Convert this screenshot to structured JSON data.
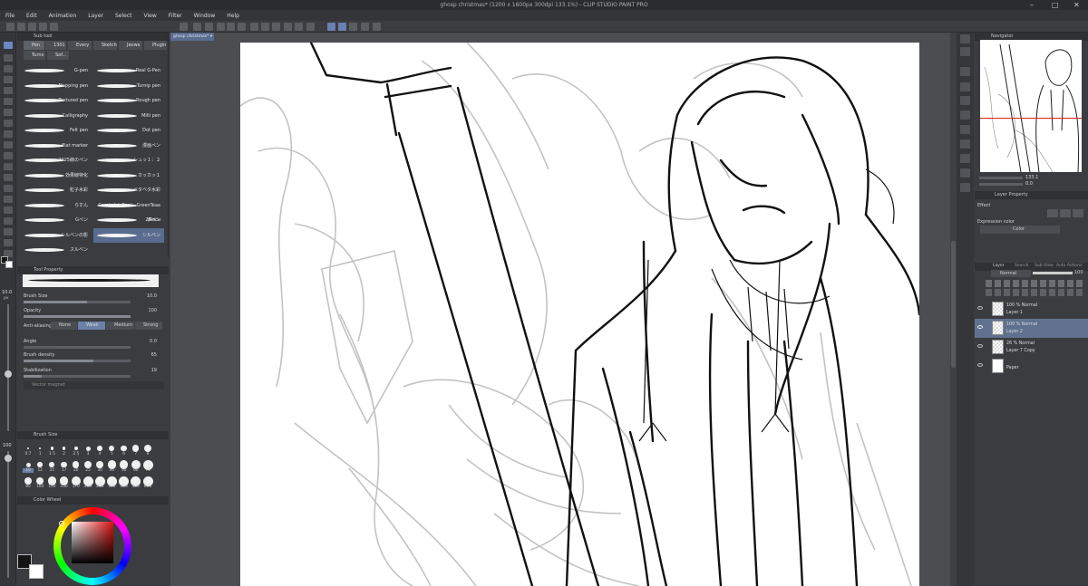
{
  "window": {
    "title": "ghosp christmas* (1200 x 1600px 300dpi 133.1%) - CLIP STUDIO PAINT PRO",
    "controls": [
      "–",
      "□",
      "✕"
    ]
  },
  "menu": [
    "File",
    "Edit",
    "Animation",
    "Layer",
    "Select",
    "View",
    "Filter",
    "Window",
    "Help"
  ],
  "document_tab": "ghosp christmas*",
  "subtool": {
    "panel_title": "Sub tool",
    "tabs_row1": [
      "Pen",
      "1301",
      "Every",
      "Sketch",
      "Jeows",
      "Plugin"
    ],
    "tabs_row2": [
      "Turns",
      "Sof..."
    ],
    "brushes_left": [
      "G-pen",
      "Mapping pen",
      "Textured pen",
      "Calligraphy",
      "Felt pen",
      "Flat marker",
      "2025線のペン",
      "効果線特化",
      "粒子水彩",
      "らすん",
      "Gペン",
      "シルベンの影",
      "スルベン"
    ],
    "brushes_right": [
      "Real G-Pen",
      "Turnip pen",
      "Rough pen",
      "Milli pen",
      "Dot pen",
      "漫画ペン",
      "シュッ１：２",
      "カッカッ１",
      "ベタベタ水彩",
      "Comic Ink Pen/☁GreenTeaa (Recu",
      "2Bペン",
      "シルベン"
    ],
    "selected_brush": "シルベン"
  },
  "tool_property": {
    "panel_title": "Tool Property",
    "brush_size": {
      "label": "Brush Size",
      "value": "10.0"
    },
    "opacity": {
      "label": "Opacity",
      "value": "100"
    },
    "anti_aliasing": {
      "label": "Anti-aliasing",
      "options": [
        "None",
        "Weak",
        "Medium",
        "Strong"
      ],
      "selected": "Weak"
    },
    "angle": {
      "label": "Angle",
      "value": "0.0"
    },
    "brush_density": {
      "label": "Brush density",
      "value": "65"
    },
    "stabilization": {
      "label": "Stabilization",
      "value": "19"
    },
    "vector_magnet": {
      "label": "Vector magnet"
    }
  },
  "left_size": {
    "value": "10.0",
    "unit": "px"
  },
  "left_opacity": {
    "value": "100"
  },
  "brush_size_panel": {
    "title": "Brush Size",
    "sizes_row1": [
      "0.7",
      "1",
      "1.5",
      "2",
      "2.5",
      "3",
      "4",
      "5",
      "6",
      "7",
      "8"
    ],
    "sizes_row2": [
      "10",
      "12",
      "15",
      "17",
      "20",
      "25",
      "30",
      "40",
      "50",
      "60",
      "70"
    ],
    "sizes_row3": [
      "80",
      "100",
      "120",
      "150",
      "170",
      "200",
      "250",
      "300",
      "400",
      "500",
      "600"
    ],
    "selected": "10"
  },
  "color_wheel": {
    "title": "Color Wheel",
    "main_color": "#141414",
    "sub_color": "#ffffff"
  },
  "navigator": {
    "title": "Navigator",
    "zoom": "133.1",
    "angle": "0.0"
  },
  "layer_property": {
    "title": "Layer Property",
    "effect_label": "Effect",
    "expression_color_label": "Expression color",
    "expression_color_value": "Color"
  },
  "layers": {
    "tabs": [
      "Layer",
      "Search",
      "Sub View",
      "Auto Actions"
    ],
    "blend_mode": "Normal",
    "opacity": "100",
    "items": [
      {
        "mode": "100 % Normal",
        "name": "Layer 1",
        "selected": false
      },
      {
        "mode": "100 % Normal",
        "name": "Layer 2",
        "selected": true
      },
      {
        "mode": "26 % Normal",
        "name": "Layer 7 Copy",
        "selected": false
      },
      {
        "mode": "",
        "name": "Paper",
        "selected": false
      }
    ]
  },
  "colors": {
    "accent": "#5d6f94",
    "panel": "#3a3c40",
    "canvas_bg": "#4b4d50"
  }
}
